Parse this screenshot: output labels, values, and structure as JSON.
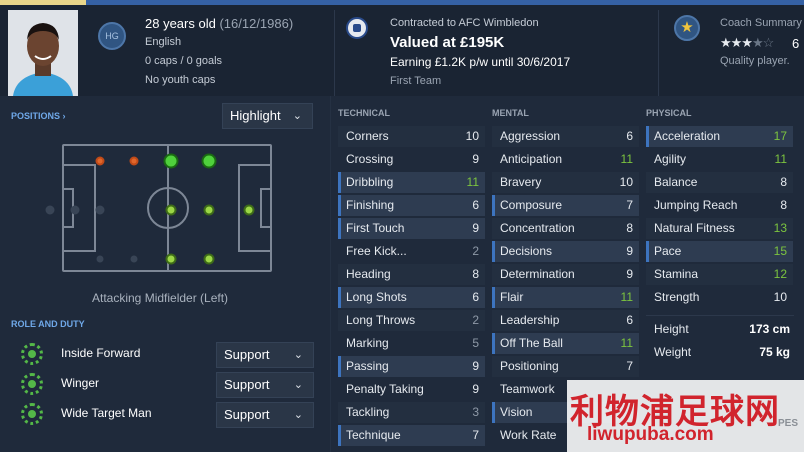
{
  "colors": {
    "accent": "#3d74bf",
    "green": "#7cc43f",
    "orange": "#e0662b",
    "bg": "#1f2a3b"
  },
  "header": {
    "badge": "HG",
    "age": "28 years old",
    "dob": "(16/12/1986)",
    "nationality": "English",
    "caps": "0 caps / 0 goals",
    "youth": "No youth caps",
    "contracted": "Contracted to AFC Wimbledon",
    "value": "Valued at £195K",
    "earning": "Earning £1.2K p/w until 30/6/2017",
    "squad": "First Team",
    "coach_title": "Coach Summary",
    "coach_stars": 3.5,
    "coach_stars_text": "★★★",
    "coach_number": "6",
    "quality": "Quality player."
  },
  "positions": {
    "title": "POSITIONS ›",
    "dropdown": "Highlight",
    "label": "Attacking Midfielder (Left)"
  },
  "roles": {
    "title": "ROLE AND DUTY",
    "items": [
      {
        "name": "Inside Forward",
        "duty": "Support"
      },
      {
        "name": "Winger",
        "duty": "Support"
      },
      {
        "name": "Wide Target Man",
        "duty": "Support"
      }
    ]
  },
  "technical": {
    "title": "TECHNICAL",
    "items": [
      {
        "name": "Corners",
        "value": "10"
      },
      {
        "name": "Crossing",
        "value": "9"
      },
      {
        "name": "Dribbling",
        "value": "11"
      },
      {
        "name": "Finishing",
        "value": "6"
      },
      {
        "name": "First Touch",
        "value": "9"
      },
      {
        "name": "Free Kick...",
        "value": "2"
      },
      {
        "name": "Heading",
        "value": "8"
      },
      {
        "name": "Long Shots",
        "value": "6"
      },
      {
        "name": "Long Throws",
        "value": "2"
      },
      {
        "name": "Marking",
        "value": "5"
      },
      {
        "name": "Passing",
        "value": "9"
      },
      {
        "name": "Penalty Taking",
        "value": "9"
      },
      {
        "name": "Tackling",
        "value": "3"
      },
      {
        "name": "Technique",
        "value": "7"
      }
    ]
  },
  "mental": {
    "title": "MENTAL",
    "items": [
      {
        "name": "Aggression",
        "value": "6"
      },
      {
        "name": "Anticipation",
        "value": "11"
      },
      {
        "name": "Bravery",
        "value": "10"
      },
      {
        "name": "Composure",
        "value": "7"
      },
      {
        "name": "Concentration",
        "value": "8"
      },
      {
        "name": "Decisions",
        "value": "9"
      },
      {
        "name": "Determination",
        "value": "9"
      },
      {
        "name": "Flair",
        "value": "11"
      },
      {
        "name": "Leadership",
        "value": "6"
      },
      {
        "name": "Off The Ball",
        "value": "11"
      },
      {
        "name": "Positioning",
        "value": "7"
      },
      {
        "name": "Teamwork",
        "value": ""
      },
      {
        "name": "Vision",
        "value": ""
      },
      {
        "name": "Work Rate",
        "value": ""
      }
    ]
  },
  "physical": {
    "title": "PHYSICAL",
    "items": [
      {
        "name": "Acceleration",
        "value": "17"
      },
      {
        "name": "Agility",
        "value": "11"
      },
      {
        "name": "Balance",
        "value": "8"
      },
      {
        "name": "Jumping Reach",
        "value": "8"
      },
      {
        "name": "Natural Fitness",
        "value": "13"
      },
      {
        "name": "Pace",
        "value": "15"
      },
      {
        "name": "Stamina",
        "value": "12"
      },
      {
        "name": "Strength",
        "value": "10"
      }
    ],
    "height_label": "Height",
    "height": "173 cm",
    "weight_label": "Weight",
    "weight": "75 kg"
  },
  "watermark": {
    "title": "利物浦足球网",
    "url": "liwupuba.com",
    "corner": "PES"
  }
}
